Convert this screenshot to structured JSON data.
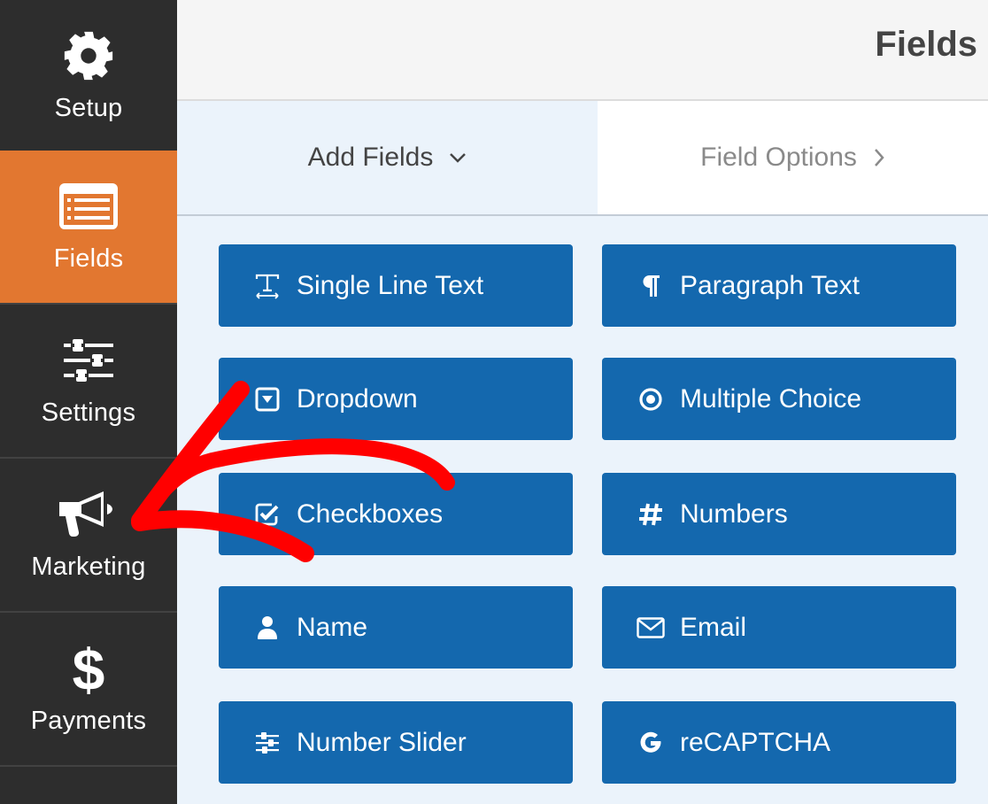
{
  "header": {
    "title": "Fields"
  },
  "sidebar": {
    "active": "fields",
    "items": [
      {
        "id": "setup",
        "label": "Setup",
        "icon": "gear-icon"
      },
      {
        "id": "fields",
        "label": "Fields",
        "icon": "list-form-icon"
      },
      {
        "id": "settings",
        "label": "Settings",
        "icon": "sliders-icon"
      },
      {
        "id": "marketing",
        "label": "Marketing",
        "icon": "megaphone-icon"
      },
      {
        "id": "payments",
        "label": "Payments",
        "icon": "dollar-icon"
      }
    ]
  },
  "tabs": {
    "add_fields": {
      "label": "Add Fields",
      "icon": "chevron-down-icon",
      "active": true
    },
    "field_options": {
      "label": "Field Options",
      "icon": "chevron-right-icon",
      "active": false
    }
  },
  "fields": [
    {
      "label": "Single Line Text",
      "icon": "text-width-icon"
    },
    {
      "label": "Paragraph Text",
      "icon": "paragraph-icon"
    },
    {
      "label": "Dropdown",
      "icon": "caret-square-down-icon"
    },
    {
      "label": "Multiple Choice",
      "icon": "dot-circle-icon"
    },
    {
      "label": "Checkboxes",
      "icon": "check-square-icon"
    },
    {
      "label": "Numbers",
      "icon": "hashtag-icon"
    },
    {
      "label": "Name",
      "icon": "user-icon"
    },
    {
      "label": "Email",
      "icon": "envelope-icon"
    },
    {
      "label": "Number Slider",
      "icon": "sliders-icon"
    },
    {
      "label": "reCAPTCHA",
      "icon": "google-icon"
    }
  ],
  "colors": {
    "sidebar_bg": "#2d2d2d",
    "sidebar_active": "#e27730",
    "field_button": "#1468ae",
    "panel_bg": "#ebf3fb",
    "annotation_arrow": "#ff0000"
  },
  "annotation": {
    "type": "hand-drawn-arrow",
    "points_to": "Marketing"
  }
}
